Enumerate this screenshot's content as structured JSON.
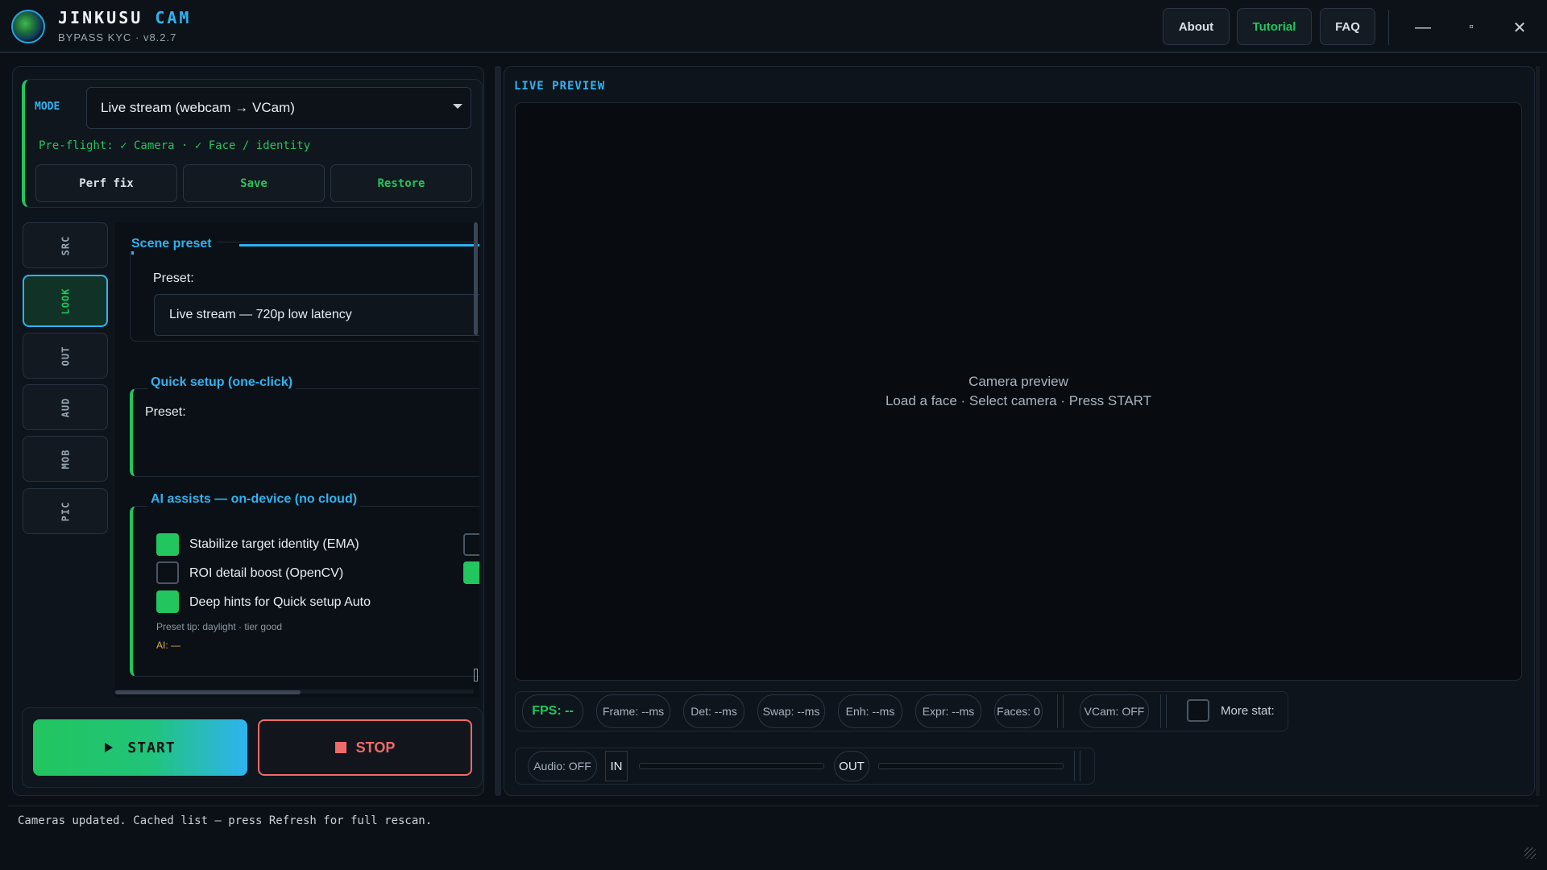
{
  "app": {
    "name_primary": "JINKUSU",
    "name_accent": "CAM",
    "subtitle": "BYPASS KYC · v8.2.7"
  },
  "topnav": {
    "about": "About",
    "tutorial": "Tutorial",
    "faq": "FAQ"
  },
  "window": {
    "minimize": "—",
    "maximize": "▫",
    "close": "✕"
  },
  "mode": {
    "label": "MODE",
    "value": "Live stream (webcam → VCam)",
    "preflight": "Pre-flight: ✓ Camera · ✓ Face / identity",
    "buttons": {
      "perf_fix": "Perf fix",
      "save": "Save",
      "restore": "Restore"
    }
  },
  "side_tabs": [
    "SRC",
    "LOOK",
    "OUT",
    "AUD",
    "MOB",
    "PIC"
  ],
  "side_tabs_active": "LOOK",
  "scene_preset": {
    "title": "Scene preset",
    "preset_label": "Preset:",
    "preset_value": "Live stream — 720p low latency"
  },
  "quick_setup": {
    "title": "Quick setup (one-click)",
    "preset_label": "Preset:"
  },
  "ai_assists": {
    "title": "AI assists — on-device (no cloud)",
    "items": [
      {
        "label": "Stabilize target identity (EMA)",
        "checked": true
      },
      {
        "label": "ROI detail boost (OpenCV)",
        "checked": false
      },
      {
        "label": "Deep hints for Quick setup Auto",
        "checked": true
      }
    ],
    "tip": "Preset tip: daylight · tier good",
    "ai_status": "AI: —"
  },
  "controls": {
    "start": "START",
    "stop": "STOP",
    "start_icon": "play-icon",
    "stop_icon": "stop-icon"
  },
  "preview": {
    "title": "LIVE PREVIEW",
    "placeholder_line1": "Camera preview",
    "placeholder_line2": "Load a face · Select camera · Press START"
  },
  "stats": {
    "fps": "FPS: --",
    "frame": "Frame: --ms",
    "det": "Det: --ms",
    "swap": "Swap: --ms",
    "enh": "Enh: --ms",
    "expr": "Expr: --ms",
    "faces": "Faces: 0",
    "vcam": "VCam: OFF",
    "more_stats": "More stat:",
    "more_stats_checked": false
  },
  "audio": {
    "status": "Audio: OFF",
    "in": "IN",
    "out": "OUT",
    "in_level": 0,
    "out_level": 0
  },
  "status_bar": "Cameras updated. Cached list — press Refresh for full rescan.",
  "colors": {
    "accent_green": "#22c55e",
    "accent_blue": "#2fb3f0",
    "stop_red": "#f06a6a",
    "background": "#0b1016"
  }
}
